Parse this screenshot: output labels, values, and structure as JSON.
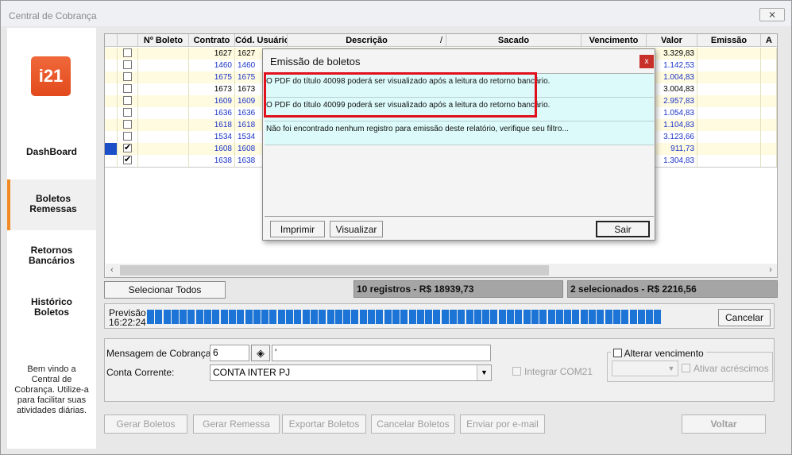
{
  "window": {
    "title": "Central de Cobrança",
    "close_label": "⨯"
  },
  "logo": {
    "text": "i21",
    "color": "#e9552a"
  },
  "sidebar": {
    "items": [
      {
        "label": "DashBoard",
        "active": false
      },
      {
        "label": "Boletos Remessas",
        "active": true
      },
      {
        "label": "Retornos Bancários",
        "active": false
      },
      {
        "label": "Histórico Boletos",
        "active": false
      }
    ],
    "welcome": "Bem vindo a Central de Cobrança. Utilize-a para facilitar suas atividades diárias."
  },
  "grid": {
    "columns": [
      "",
      "",
      "Nº Boleto",
      "Contrato",
      "Cód. Usuário",
      "Descrição",
      "Sacado",
      "Vencimento",
      "Valor",
      "Emissão",
      "A"
    ],
    "sort_glyph": "/",
    "rows": [
      {
        "checked": false,
        "contrato": "1627",
        "cod": "1627",
        "valor": "3.329,83",
        "blue": false
      },
      {
        "checked": false,
        "contrato": "1460",
        "cod": "1460",
        "valor": "1.142,53",
        "blue": true
      },
      {
        "checked": false,
        "contrato": "1675",
        "cod": "1675",
        "valor": "1.004,83",
        "blue": true
      },
      {
        "checked": false,
        "contrato": "1673",
        "cod": "1673",
        "valor": "3.004,83",
        "blue": false
      },
      {
        "checked": false,
        "contrato": "1609",
        "cod": "1609",
        "valor": "2.957,83",
        "blue": true
      },
      {
        "checked": false,
        "contrato": "1636",
        "cod": "1636",
        "valor": "1.054,83",
        "blue": true
      },
      {
        "checked": false,
        "contrato": "1618",
        "cod": "1618",
        "valor": "1.104,83",
        "blue": true
      },
      {
        "checked": false,
        "contrato": "1534",
        "cod": "1534",
        "valor": "3.123,66",
        "blue": true
      },
      {
        "checked": true,
        "contrato": "1608",
        "cod": "1608",
        "valor": "911,73",
        "blue": true
      },
      {
        "checked": true,
        "contrato": "1638",
        "cod": "1638",
        "valor": "1.304,83",
        "blue": true
      }
    ],
    "scroll_left": "‹",
    "scroll_right": "›"
  },
  "actions": {
    "select_all": "Selecionar Todos",
    "total_records": "10 registros - R$ 18939,73",
    "selected_records": "2 selecionados - R$ 2216,56"
  },
  "progress": {
    "label": "Previsão",
    "time": "16:22:24",
    "fraction": 1.0,
    "cancel": "Cancelar"
  },
  "form": {
    "mensagem_label": "Mensagem de Cobrança:",
    "mensagem_code": "6",
    "mensagem_text": "'",
    "conta_label": "Conta Corrente:",
    "conta_value": "CONTA INTER PJ",
    "integrar": "Integrar COM21",
    "alterar_vencimento": "Alterar vencimento",
    "ativar_acrescimos": "Ativar acréscimos"
  },
  "footer_buttons": {
    "gerar_boletos": "Gerar  Boletos",
    "gerar_remessa": "Gerar Remessa",
    "exportar": "Exportar Boletos",
    "cancelar": "Cancelar Boletos",
    "email": "Enviar por e-mail",
    "voltar": "Voltar"
  },
  "dialog": {
    "title": "Emissão de boletos",
    "close": "x",
    "messages": [
      "O PDF do título 40098 poderá ser visualizado após a leitura do retorno bancário.",
      "O PDF do título 40099 poderá ser visualizado após a leitura do retorno bancário.",
      "Não foi encontrado nenhum registro para emissão deste relatório, verifique seu filtro..."
    ],
    "imprimir": "Imprimir",
    "visualizar": "Visualizar",
    "sair": "Sair"
  },
  "colors": {
    "accent": "#f08a24",
    "blue_text": "#1a33c8",
    "progress": "#1c74d6",
    "highlight": "#e0101c",
    "row_yellow": "#fffbe0"
  }
}
